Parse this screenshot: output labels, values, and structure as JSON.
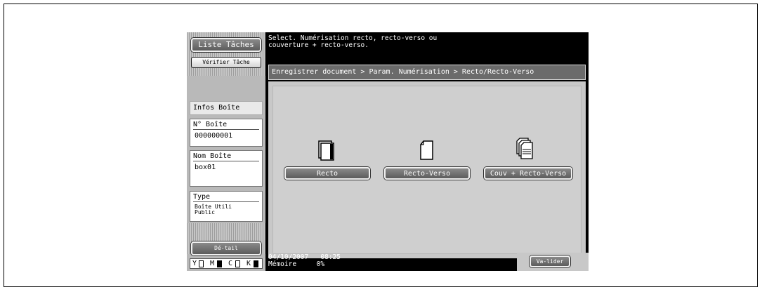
{
  "left": {
    "job_list_label": "Liste Tâches",
    "check_job_label": "Vérifier Tâche",
    "box_info_label": "Infos Boîte",
    "box_number_title": "N° Boîte",
    "box_number_value": "000000001",
    "box_name_title": "Nom Boîte",
    "box_name_value": "box01",
    "type_title": "Type",
    "type_value": "Boîte Utili Public",
    "detail_label": "Dé-tail"
  },
  "toner": {
    "y": "Y",
    "m": "M",
    "c": "C",
    "k": "K"
  },
  "message": {
    "line1": "Select. Numérisation recto, recto-verso ou",
    "line2": "couverture + recto-verso."
  },
  "breadcrumb": "Enregistrer document > Param. Numérisation  > Recto/Recto-Verso",
  "options": {
    "recto": "Recto",
    "recto_verso": "Recto-Verso",
    "cover": "Couv + Recto-Verso"
  },
  "status": {
    "date": "04/10/2007",
    "time": "08:25",
    "memory_label": "Mémoire",
    "memory_value": "0%"
  },
  "validate_label": "Va-lider"
}
